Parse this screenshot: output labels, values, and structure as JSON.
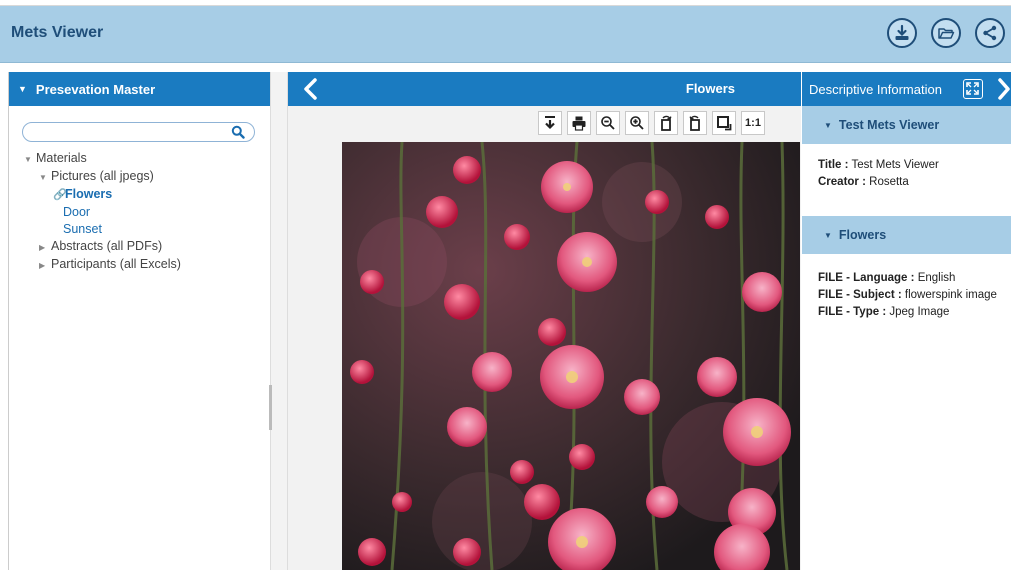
{
  "app": {
    "title": "Mets Viewer"
  },
  "header_buttons": [
    {
      "icon": "download-icon"
    },
    {
      "icon": "folder-open-icon"
    },
    {
      "icon": "share-icon"
    }
  ],
  "left_panel": {
    "title": "Presevation Master",
    "search": {
      "value": "",
      "placeholder": ""
    },
    "tree": {
      "materials": "Materials",
      "pictures": "Pictures (all jpegs)",
      "flowers": "Flowers",
      "door": "Door",
      "sunset": "Sunset",
      "abstracts": "Abstracts (all PDFs)",
      "participants": "Participants (all Excels)"
    }
  },
  "viewer": {
    "title": "Flowers",
    "toolbar": {
      "one_to_one": "1:1"
    }
  },
  "right_panel": {
    "title": "Descriptive Information",
    "section1": {
      "title": "Test Mets Viewer",
      "title_label": "Title :",
      "title_value": "Test Mets Viewer",
      "creator_label": "Creator :",
      "creator_value": "Rosetta"
    },
    "section2": {
      "title": "Flowers",
      "lang_label": "FILE - Language :",
      "lang_value": "English",
      "subject_label": "FILE - Subject :",
      "subject_value": "flowerspink image",
      "type_label": "FILE - Type :",
      "type_value": "Jpeg Image"
    }
  },
  "colors": {
    "header": "#a7cde6",
    "panel_bar": "#1a7bc1",
    "accent_text": "#1f4e79"
  }
}
